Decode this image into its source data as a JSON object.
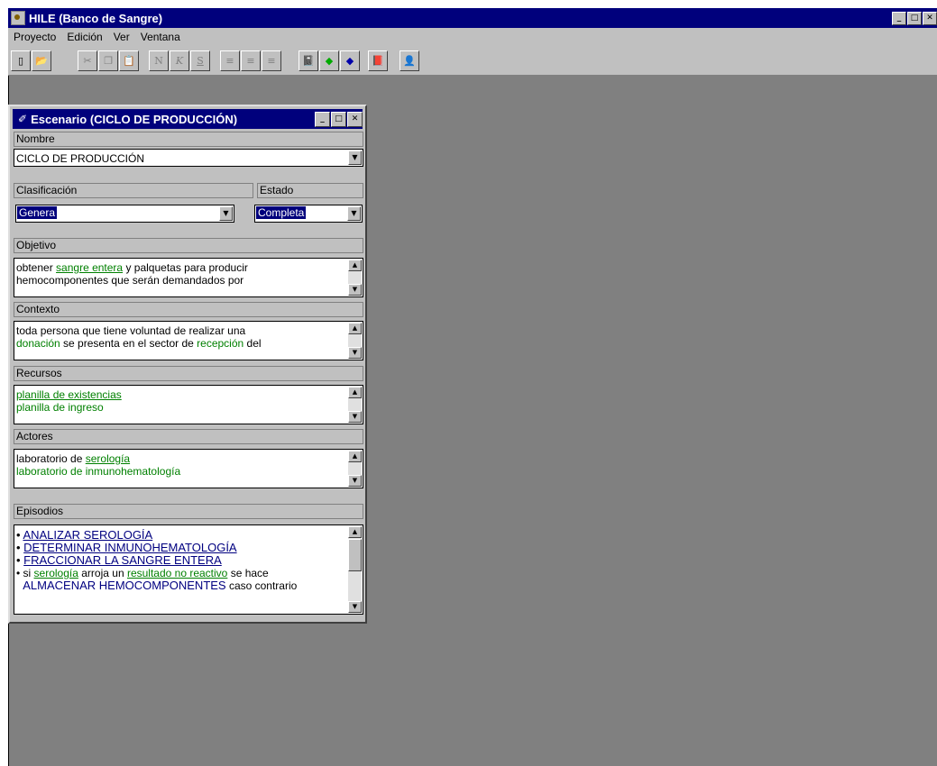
{
  "app": {
    "title": "HILE (Banco de Sangre)",
    "icon": "app-icon"
  },
  "window_buttons": [
    "_",
    "□",
    "✕"
  ],
  "menu": [
    "Proyecto",
    "Edición",
    "Ver",
    "Ventana"
  ],
  "toolbar": {
    "items": [
      {
        "name": "new-document-icon",
        "glyph": "▯",
        "enabled": true
      },
      {
        "name": "open-folder-icon",
        "glyph": "📂",
        "enabled": true
      },
      {
        "name": "cut-icon",
        "glyph": "✂",
        "enabled": false
      },
      {
        "name": "copy-icon",
        "glyph": "❐",
        "enabled": false
      },
      {
        "name": "paste-icon",
        "glyph": "📋",
        "enabled": false
      },
      {
        "name": "bold-icon",
        "glyph": "N",
        "enabled": false
      },
      {
        "name": "italic-icon",
        "glyph": "K",
        "enabled": false
      },
      {
        "name": "underline-icon",
        "glyph": "S",
        "enabled": false
      },
      {
        "name": "align-left-icon",
        "glyph": "≡",
        "enabled": false
      },
      {
        "name": "align-center-icon",
        "glyph": "≡",
        "enabled": false
      },
      {
        "name": "align-right-icon",
        "glyph": "≡",
        "enabled": false
      },
      {
        "name": "notebook-icon",
        "glyph": "📓",
        "enabled": true
      },
      {
        "name": "green-eraser-icon",
        "glyph": "◆",
        "enabled": true
      },
      {
        "name": "blue-eraser-icon",
        "glyph": "◆",
        "enabled": true
      },
      {
        "name": "book-icon",
        "glyph": "📕",
        "enabled": true
      },
      {
        "name": "person-icon",
        "glyph": "👤",
        "enabled": true
      }
    ]
  },
  "scenario_window": {
    "title": "Escenario (CICLO DE PRODUCCIÓN)",
    "nombre": {
      "label": "Nombre",
      "value": "CICLO DE PRODUCCIÓN"
    },
    "clasificacion": {
      "label": "Clasificación",
      "value": "Genera"
    },
    "estado": {
      "label": "Estado",
      "value": "Completa"
    },
    "objetivo": {
      "label": "Objetivo",
      "line1_a": "obtener ",
      "line1_link": "sangre entera",
      "line1_b": " y palquetas para producir",
      "line2": "hemocomponentes que serán demandados por"
    },
    "contexto": {
      "label": "Contexto",
      "line1": "toda persona que tiene voluntad de realizar una",
      "line2_link1": "donación",
      "line2_a": " se presenta en el sector de ",
      "line2_link2": "recepción",
      "line2_b": " del"
    },
    "recursos": {
      "label": "Recursos",
      "item1": "planilla de existencias",
      "item2": "planilla de ingreso"
    },
    "actores": {
      "label": "Actores",
      "line1_a": "laboratorio de ",
      "line1_link": "serología",
      "line2": "laboratorio de inmunohematología"
    },
    "episodios": {
      "label": "Episodios",
      "ep1": "ANALIZAR SEROLOGÍA",
      "ep2": "DETERMINAR INMUNOHEMATOLOGÍA",
      "ep3": "FRACCIONAR LA SANGRE ENTERA",
      "ep4_a": "si ",
      "ep4_link1": "serología",
      "ep4_b": " arroja un ",
      "ep4_link2": "resultado no reactivo",
      "ep4_c": " se hace",
      "ep5_a": "ALMACENAR HEMOCOMPONENTES",
      "ep5_b": " caso contrario"
    }
  },
  "colors": {
    "titlebar": "#00007c",
    "face": "#c0c0c0",
    "workspace": "#808080",
    "link": "#008000"
  }
}
